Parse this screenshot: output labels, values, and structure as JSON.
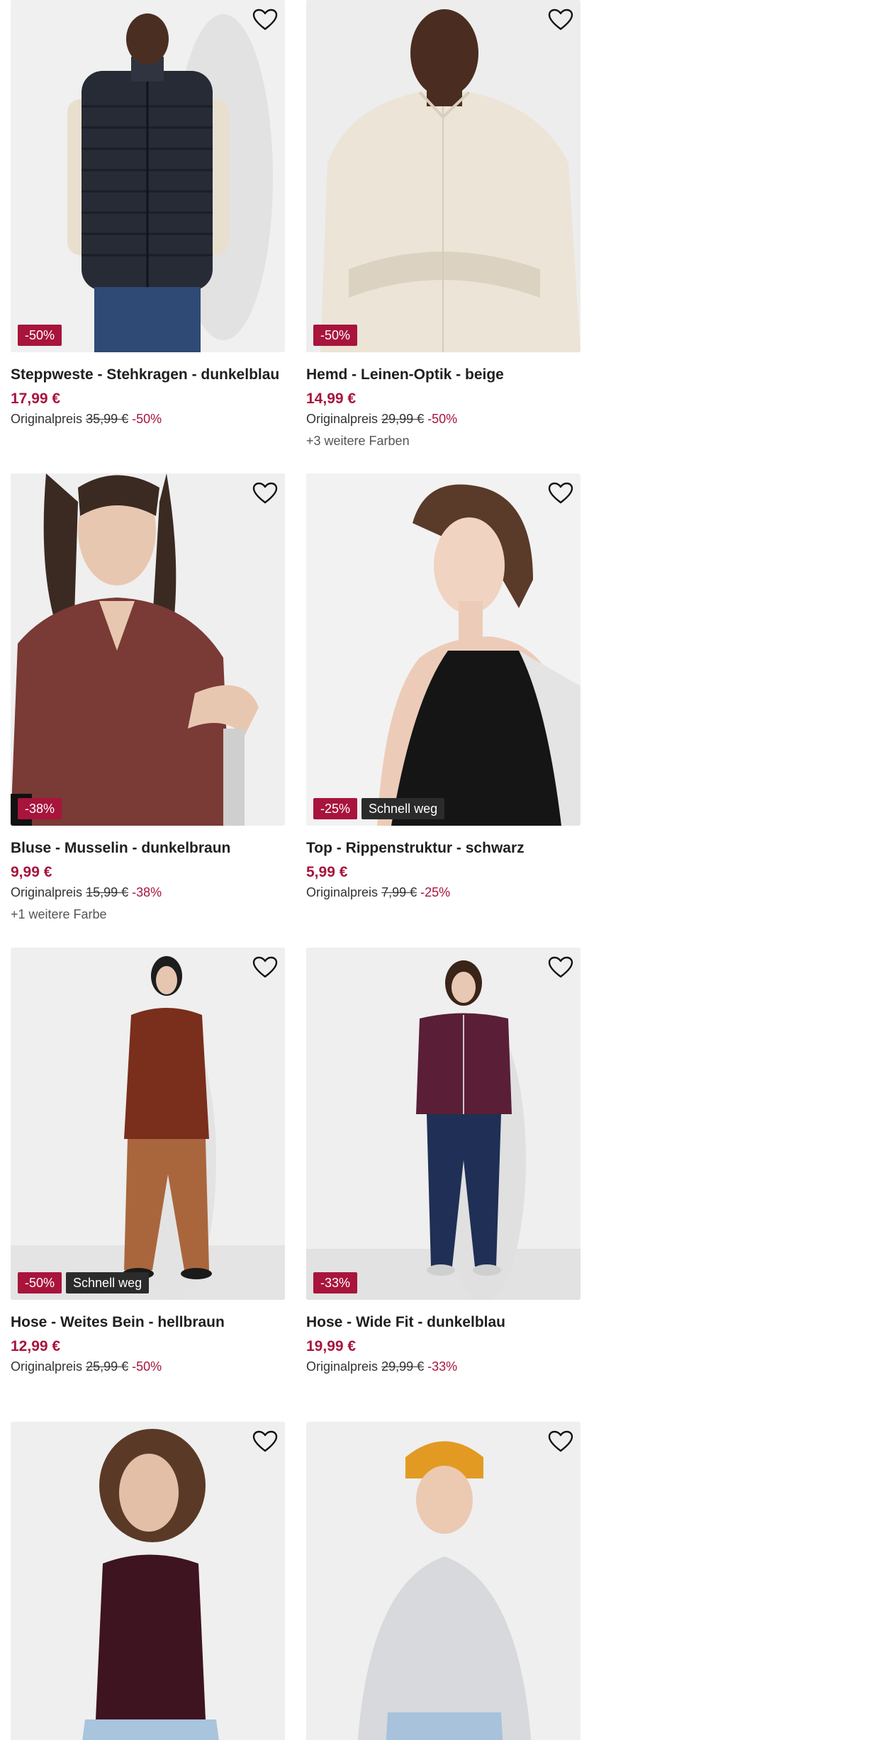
{
  "products": [
    {
      "title": "Steppweste - Stehkragen - dunkelblau",
      "price": "17,99 €",
      "orig_label": "Originalpreis",
      "orig_price": "35,99 €",
      "discount": "-50%",
      "badge_sale": "-50%",
      "badge_fast": "",
      "colors": ""
    },
    {
      "title": "Hemd - Leinen-Optik - beige",
      "price": "14,99 €",
      "orig_label": "Originalpreis",
      "orig_price": "29,99 €",
      "discount": "-50%",
      "badge_sale": "-50%",
      "badge_fast": "",
      "colors": "+3 weitere Farben"
    },
    {
      "title": "Bluse - Musselin - dunkelbraun",
      "price": "9,99 €",
      "orig_label": "Originalpreis",
      "orig_price": "15,99 €",
      "discount": "-38%",
      "badge_sale": "-38%",
      "badge_fast": "",
      "colors": "+1 weitere Farbe"
    },
    {
      "title": "Top - Rippenstruktur - schwarz",
      "price": "5,99 €",
      "orig_label": "Originalpreis",
      "orig_price": "7,99 €",
      "discount": "-25%",
      "badge_sale": "-25%",
      "badge_fast": "Schnell weg",
      "colors": ""
    },
    {
      "title": "Hose - Weites Bein - hellbraun",
      "price": "12,99 €",
      "orig_label": "Originalpreis",
      "orig_price": "25,99 €",
      "discount": "-50%",
      "badge_sale": "-50%",
      "badge_fast": "Schnell weg",
      "colors": ""
    },
    {
      "title": "Hose - Wide Fit - dunkelblau",
      "price": "19,99 €",
      "orig_label": "Originalpreis",
      "orig_price": "29,99 €",
      "discount": "-33%",
      "badge_sale": "-33%",
      "badge_fast": "",
      "colors": ""
    },
    {
      "title": "",
      "price": "",
      "orig_label": "",
      "orig_price": "",
      "discount": "",
      "badge_sale": "",
      "badge_fast": "",
      "colors": ""
    },
    {
      "title": "",
      "price": "",
      "orig_label": "",
      "orig_price": "",
      "discount": "",
      "badge_sale": "",
      "badge_fast": "",
      "colors": ""
    }
  ],
  "colors": {
    "sale": "#a8143c",
    "fast_badge": "#2b2b2b",
    "photo_bg": "#eeeeee"
  },
  "icons": {
    "favorite": "heart-outline-icon"
  }
}
